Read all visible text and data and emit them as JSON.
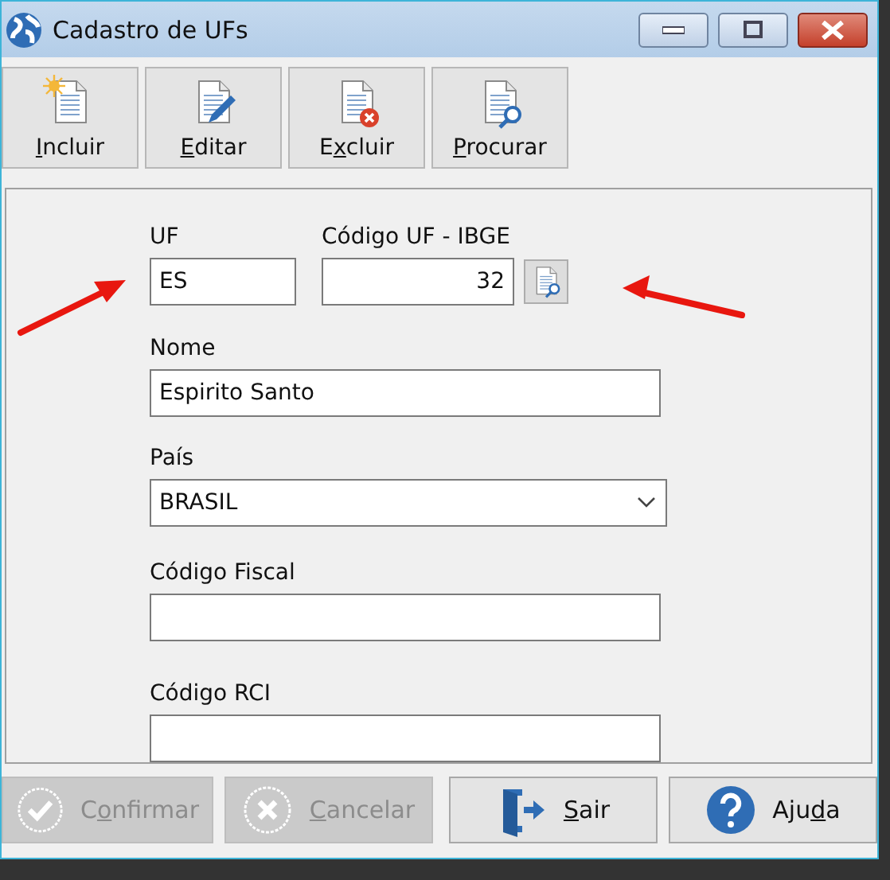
{
  "window": {
    "title": "Cadastro de UFs"
  },
  "toolbar": [
    {
      "kind": "new",
      "key": "I",
      "post": "ncluir"
    },
    {
      "kind": "edit",
      "key": "E",
      "post": "ditar"
    },
    {
      "kind": "delete",
      "pre": "E",
      "key": "x",
      "post": "cluir"
    },
    {
      "kind": "search",
      "key": "P",
      "post": "rocurar"
    }
  ],
  "form": {
    "uf": {
      "label": "UF",
      "value": "ES"
    },
    "codigo_ibge": {
      "label": "Código UF - IBGE",
      "value": "32"
    },
    "nome": {
      "label": "Nome",
      "value": "Espirito Santo"
    },
    "pais": {
      "label": "País",
      "value": "BRASIL"
    },
    "codigo_fiscal": {
      "label": "Código Fiscal"
    },
    "codigo_rci": {
      "label": "Código RCI"
    }
  },
  "buttons": [
    {
      "kind": "confirm",
      "pre": "C",
      "key": "o",
      "post": "nfirmar",
      "disabled": true
    },
    {
      "kind": "cancel",
      "key": "C",
      "post": "ancelar",
      "disabled": true
    },
    {
      "kind": "exit",
      "key": "S",
      "post": "air",
      "disabled": false
    },
    {
      "kind": "help",
      "pre": "Aju",
      "key": "d",
      "post": "a",
      "disabled": false
    }
  ]
}
